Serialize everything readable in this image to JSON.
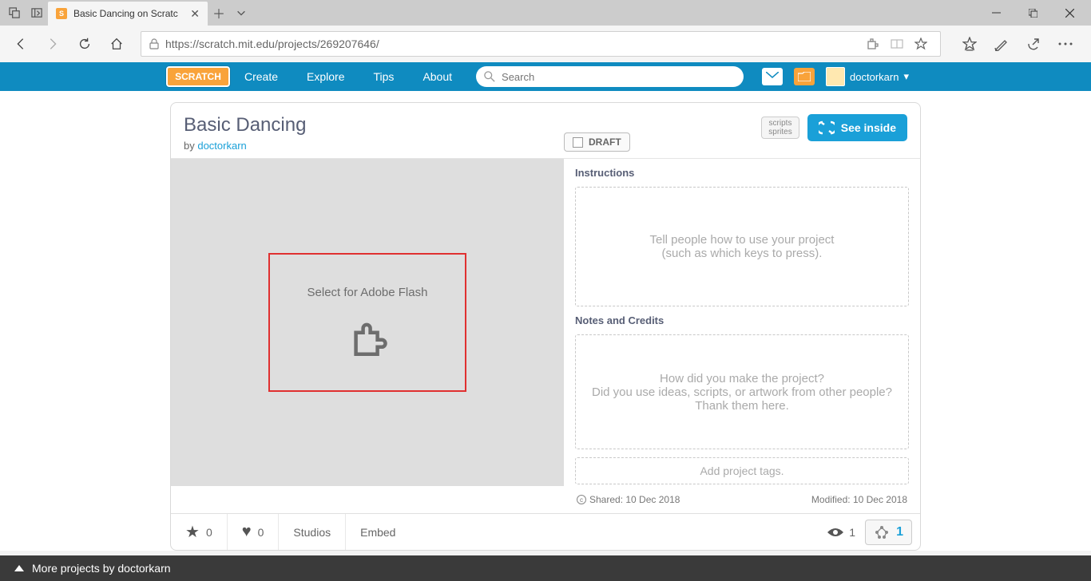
{
  "browser": {
    "tab_title": "Basic Dancing on Scratc",
    "url": "https://scratch.mit.edu/projects/269207646/"
  },
  "nav": {
    "create": "Create",
    "explore": "Explore",
    "tips": "Tips",
    "about": "About",
    "search_placeholder": "Search",
    "username": "doctorkarn"
  },
  "project": {
    "title": "Basic Dancing",
    "by_prefix": "by ",
    "author": "doctorkarn",
    "draft_label": "DRAFT",
    "scripts_label": "scripts",
    "sprites_label": "sprites",
    "see_inside": "See inside",
    "flash_text": "Select for Adobe Flash",
    "instructions_label": "Instructions",
    "instructions_placeholder": "Tell people how to use your project\n(such as which keys to press).",
    "notes_label": "Notes and Credits",
    "notes_placeholder": "How did you make the project?\nDid you use ideas, scripts, or artwork from other people? Thank them here.",
    "tags_placeholder": "Add project tags.",
    "shared": "Shared: 10 Dec 2018",
    "modified": "Modified: 10 Dec 2018"
  },
  "stats": {
    "fav_count": "0",
    "love_count": "0",
    "studios": "Studios",
    "embed": "Embed",
    "views": "1",
    "remix_count": "1"
  },
  "footer": {
    "more_projects": "More projects by doctorkarn"
  }
}
